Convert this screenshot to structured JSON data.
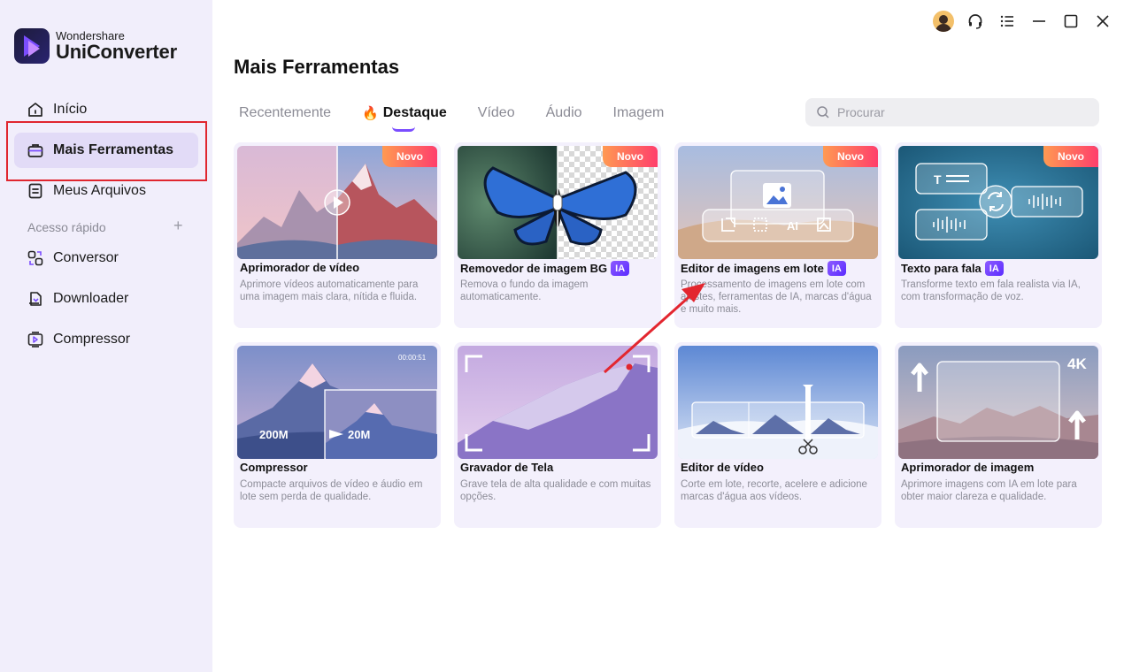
{
  "app": {
    "brand": "Wondershare",
    "product": "UniConverter"
  },
  "sidebar": {
    "items": [
      {
        "label": "Início",
        "icon": "home-icon"
      },
      {
        "label": "Mais Ferramentas",
        "icon": "toolbox-icon",
        "active": true
      },
      {
        "label": "Meus Arquivos",
        "icon": "file-icon"
      }
    ],
    "quick_label": "Acesso rápido",
    "quick_add": "+",
    "quick_items": [
      {
        "label": "Conversor",
        "icon": "converter-icon"
      },
      {
        "label": "Downloader",
        "icon": "download-icon"
      },
      {
        "label": "Compressor",
        "icon": "compress-icon"
      }
    ]
  },
  "main": {
    "title": "Mais Ferramentas",
    "tabs": [
      {
        "label": "Recentemente"
      },
      {
        "label": "Destaque",
        "active": true
      },
      {
        "label": "Vídeo"
      },
      {
        "label": "Áudio"
      },
      {
        "label": "Imagem"
      }
    ],
    "search_placeholder": "Procurar"
  },
  "cards": [
    {
      "name": "Aprimorador de vídeo",
      "desc": "Aprimore vídeos automaticamente para uma imagem mais clara, nítida e fluida.",
      "badge": "Novo",
      "ia": ""
    },
    {
      "name": "Removedor de imagem BG",
      "desc": "Remova o fundo da imagem automaticamente.",
      "badge": "Novo",
      "ia": "IA"
    },
    {
      "name": "Editor de imagens em lote",
      "desc": "Processamento de imagens em lote com ajustes, ferramentas de IA, marcas d'água e muito mais.",
      "badge": "Novo",
      "ia": "IA"
    },
    {
      "name": "Texto para fala",
      "desc": "Transforme texto em fala realista via IA, com transformação de voz.",
      "badge": "Novo",
      "ia": "IA"
    },
    {
      "name": "Compressor",
      "desc": "Compacte arquivos de vídeo e áudio em lote sem perda de qualidade.",
      "badge": "",
      "ia": "",
      "thumb_text": {
        "time": "00:00:51",
        "from": "200M",
        "to": "20M"
      }
    },
    {
      "name": "Gravador de Tela",
      "desc": "Grave tela de alta qualidade e com muitas opções.",
      "badge": "",
      "ia": ""
    },
    {
      "name": "Editor de vídeo",
      "desc": "Corte em lote, recorte, acelere e adicione marcas d'água aos vídeos.",
      "badge": "",
      "ia": ""
    },
    {
      "name": "Aprimorador de imagem",
      "desc": "Aprimore imagens com IA em lote para obter maior clareza e qualidade.",
      "badge": "",
      "ia": "",
      "thumb_text": {
        "res": "4K"
      }
    }
  ],
  "colors": {
    "accent": "#7a4dff",
    "highlight_box": "#e0262f",
    "arrow": "#e3262f",
    "sidebar_bg": "#f1eefb"
  }
}
